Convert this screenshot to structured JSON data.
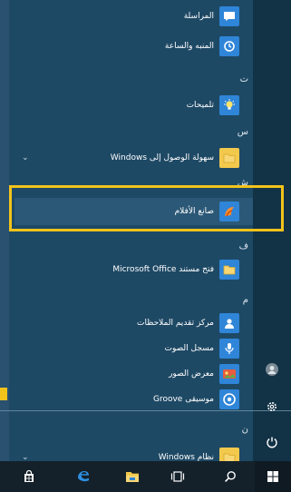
{
  "start_menu": {
    "items": [
      {
        "label": "المراسلة",
        "icon": "messaging-icon",
        "tile_color": "#2f85d8"
      },
      {
        "label": "المنبه والساعة",
        "icon": "alarm-clock-icon",
        "tile_color": "#2f85d8"
      },
      {
        "label": "تلميحات",
        "icon": "lightbulb-icon",
        "tile_color": "#2f85d8"
      },
      {
        "label": "سهولة الوصول إلى Windows",
        "icon": "folder-icon",
        "tile_color": "#f2c94c"
      },
      {
        "label": "صانع الأفلام",
        "icon": "movie-maker-icon",
        "tile_color": "#2f85d8"
      },
      {
        "label": "فتح مستند Microsoft Office",
        "icon": "office-folder-icon",
        "tile_color": "#2f85d8"
      },
      {
        "label": "مركز تقديم الملاحظات",
        "icon": "feedback-hub-icon",
        "tile_color": "#2f85d8"
      },
      {
        "label": "مسجل الصوت",
        "icon": "voice-recorder-icon",
        "tile_color": "#2f85d8"
      },
      {
        "label": "معرض الصور",
        "icon": "photo-gallery-icon",
        "tile_color": "#2f85d8"
      },
      {
        "label": "موسيقى Groove",
        "icon": "groove-music-icon",
        "tile_color": "#2f85d8"
      },
      {
        "label": "نظام Windows",
        "icon": "folder-icon",
        "tile_color": "#f2c94c"
      }
    ],
    "headers": [
      "ت",
      "س",
      "ش",
      "ف",
      "م",
      "ن"
    ],
    "highlight_color": "#f2c31b",
    "chevron": "⌄"
  },
  "taskbar": {
    "icons": [
      "start-icon",
      "search-icon",
      "task-view-icon",
      "file-explorer-icon",
      "edge-icon",
      "store-icon"
    ]
  },
  "side": {
    "icons": [
      "user-avatar-icon",
      "settings-icon",
      "power-icon"
    ]
  }
}
